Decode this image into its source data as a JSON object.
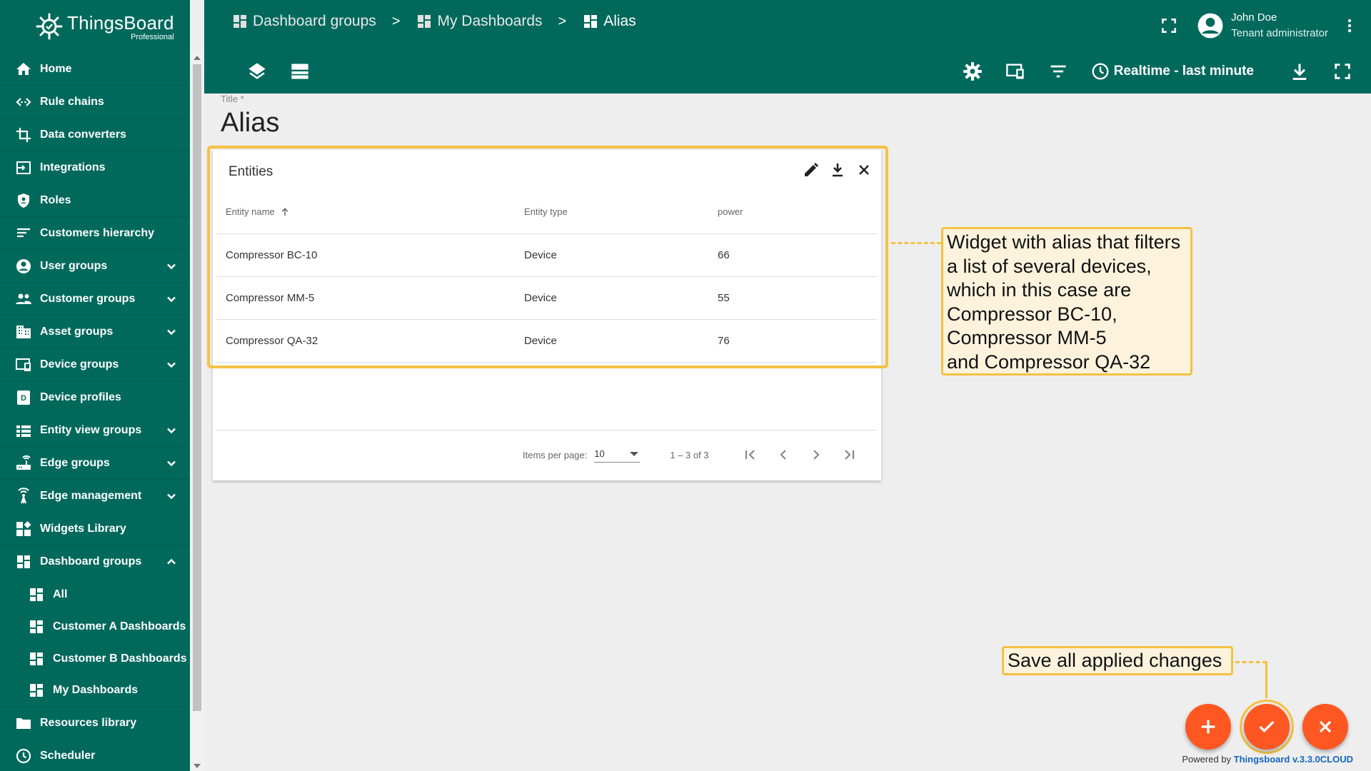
{
  "app": {
    "logo_name": "ThingsBoard",
    "logo_sub": "Professional"
  },
  "sidebar": {
    "items": [
      {
        "label": "Home",
        "icon": "home-icon"
      },
      {
        "label": "Rule chains",
        "icon": "rule-chain-icon"
      },
      {
        "label": "Data converters",
        "icon": "converter-icon"
      },
      {
        "label": "Integrations",
        "icon": "integration-icon"
      },
      {
        "label": "Roles",
        "icon": "shield-icon"
      },
      {
        "label": "Customers hierarchy",
        "icon": "hierarchy-icon"
      },
      {
        "label": "User groups",
        "icon": "account-icon",
        "expandable": true
      },
      {
        "label": "Customer groups",
        "icon": "people-icon",
        "expandable": true
      },
      {
        "label": "Asset groups",
        "icon": "building-icon",
        "expandable": true
      },
      {
        "label": "Device groups",
        "icon": "devices-icon",
        "expandable": true
      },
      {
        "label": "Device profiles",
        "icon": "device-profile-icon"
      },
      {
        "label": "Entity view groups",
        "icon": "view-list-icon",
        "expandable": true
      },
      {
        "label": "Edge groups",
        "icon": "router-icon",
        "expandable": true
      },
      {
        "label": "Edge management",
        "icon": "antenna-icon",
        "expandable": true
      },
      {
        "label": "Widgets Library",
        "icon": "widgets-icon"
      },
      {
        "label": "Dashboard groups",
        "icon": "dashboard-icon",
        "expanded": true
      }
    ],
    "dashboard_sub": [
      "All",
      "Customer A Dashboards",
      "Customer B Dashboards",
      "My Dashboards"
    ],
    "tail_items": [
      {
        "label": "Resources library",
        "icon": "folder-icon"
      },
      {
        "label": "Scheduler",
        "icon": "clock-icon"
      }
    ]
  },
  "breadcrumb": {
    "items": [
      "Dashboard groups",
      "My Dashboards",
      "Alias"
    ],
    "separator": ">"
  },
  "user": {
    "name": "John Doe",
    "role": "Tenant administrator"
  },
  "toolbar": {
    "timewindow": "Realtime - last minute"
  },
  "dashboard": {
    "title_label": "Title *",
    "title": "Alias"
  },
  "widget": {
    "title": "Entities",
    "columns": [
      "Entity name",
      "Entity type",
      "power"
    ],
    "rows": [
      [
        "Compressor BC-10",
        "Device",
        "66"
      ],
      [
        "Compressor MM-5",
        "Device",
        "55"
      ],
      [
        "Compressor QA-32",
        "Device",
        "76"
      ]
    ],
    "paginator": {
      "items_per_page_label": "Items per page:",
      "items_per_page_value": "10",
      "range": "1 – 3 of 3"
    }
  },
  "callouts": {
    "widget_lines": [
      "Widget with alias that filters",
      "a list of several devices,",
      "which in this case are",
      "Compressor BC-10,",
      "Compressor MM-5",
      "and Compressor QA-32"
    ],
    "save": "Save all applied changes"
  },
  "footer": {
    "powered_prefix": "Powered by ",
    "powered_link": "Thingsboard v.3.3.0CLOUD"
  },
  "colors": {
    "primary": "#00695c",
    "accent": "#ff5722",
    "callout_border": "#f4c243",
    "callout_bg": "#fdf3dd"
  }
}
